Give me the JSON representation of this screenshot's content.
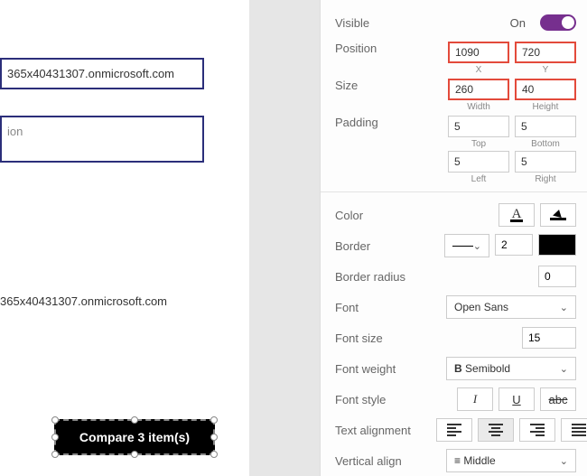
{
  "canvas": {
    "email1": "365x40431307.onmicrosoft.com",
    "textbox_placeholder": "ion",
    "email2": "365x40431307.onmicrosoft.com",
    "compare_label": "Compare 3 item(s)"
  },
  "panel": {
    "visible": {
      "label": "Visible",
      "state": "On"
    },
    "position": {
      "label": "Position",
      "x": "1090",
      "x_sub": "X",
      "y": "720",
      "y_sub": "Y"
    },
    "size": {
      "label": "Size",
      "w": "260",
      "w_sub": "Width",
      "h": "40",
      "h_sub": "Height"
    },
    "padding": {
      "label": "Padding",
      "top": "5",
      "top_sub": "Top",
      "bottom": "5",
      "bottom_sub": "Bottom",
      "left": "5",
      "left_sub": "Left",
      "right": "5",
      "right_sub": "Right"
    },
    "color": {
      "label": "Color"
    },
    "border": {
      "label": "Border",
      "width": "2"
    },
    "border_radius": {
      "label": "Border radius",
      "value": "0"
    },
    "font": {
      "label": "Font",
      "value": "Open Sans"
    },
    "font_size": {
      "label": "Font size",
      "value": "15"
    },
    "font_weight": {
      "label": "Font weight",
      "value": "Semibold"
    },
    "font_style": {
      "label": "Font style"
    },
    "text_align": {
      "label": "Text alignment"
    },
    "vertical_align": {
      "label": "Vertical align",
      "value": "Middle"
    }
  }
}
